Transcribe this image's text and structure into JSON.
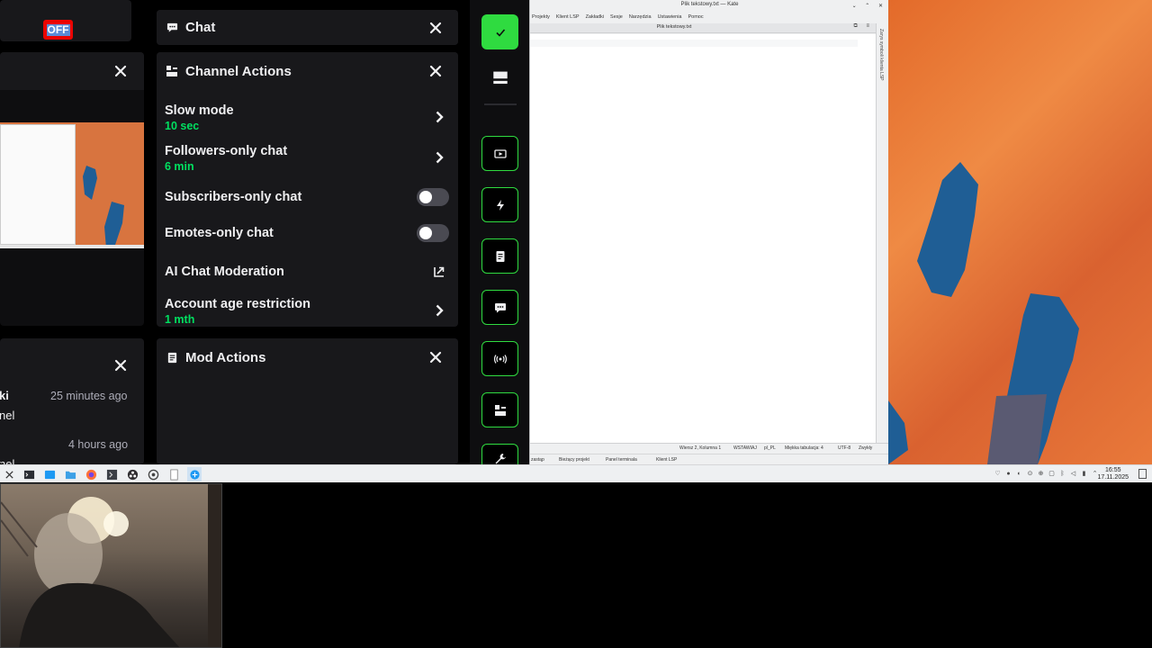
{
  "status": {
    "badge": "OFF"
  },
  "chat_card": {
    "title": "Chat"
  },
  "channel_actions": {
    "title": "Channel Actions",
    "rows": [
      {
        "label": "Slow mode",
        "value": "10 sec",
        "control": "chevron"
      },
      {
        "label": "Followers-only chat",
        "value": "6 min",
        "control": "chevron"
      },
      {
        "label": "Subscribers-only chat",
        "control": "toggle",
        "on": false
      },
      {
        "label": "Emotes-only chat",
        "control": "toggle",
        "on": false
      },
      {
        "label": "AI Chat Moderation",
        "control": "external-link"
      },
      {
        "label": "Account age restriction",
        "value": "1 mth",
        "control": "chevron"
      }
    ]
  },
  "mod_actions": {
    "title": "Mod Actions"
  },
  "activity": {
    "rows": [
      {
        "name_fragment": "ki",
        "detail_fragment": "nel",
        "time": "25 minutes ago"
      },
      {
        "name_fragment": "",
        "detail_fragment": "nel",
        "time": "4 hours ago"
      }
    ]
  },
  "quick_actions": [
    {
      "icon": "check-icon",
      "active": true
    },
    {
      "icon": "layout-icon"
    },
    {
      "icon": "clip-icon"
    },
    {
      "icon": "lightning-icon"
    },
    {
      "icon": "notes-icon"
    },
    {
      "icon": "chat-bubble-icon"
    },
    {
      "icon": "broadcast-icon"
    },
    {
      "icon": "channel-actions-icon"
    },
    {
      "icon": "wrench-icon"
    }
  ],
  "kate": {
    "window_title": "Plik tekstowy.txt — Kate",
    "menu": [
      "Projekty",
      "Klient LSP",
      "Zakładki",
      "Sesje",
      "Narzędzia",
      "Ustawienia",
      "Pomoc"
    ],
    "tab": "Plik tekstowy.txt",
    "side_panel": "Zarys symboli klienta LSP",
    "status": {
      "position": "Wiersz 2, Kolumna 1",
      "mode": "WSTAWIAJ",
      "lang": "pl_PL",
      "indent": "Miękka tabulacja: 4",
      "encoding": "UTF-8",
      "syntax": "Zwykły"
    },
    "bottom": [
      "zastąp",
      "Bieżący projekt",
      "Panel terminala",
      "Klient LSP"
    ]
  },
  "taskbar": {
    "time": "16:55",
    "date": "17.11.2025"
  },
  "colors": {
    "accent_green": "#2fdb40",
    "value_green": "#00e060",
    "off_red": "#eb0400",
    "panel": "#18181b"
  }
}
